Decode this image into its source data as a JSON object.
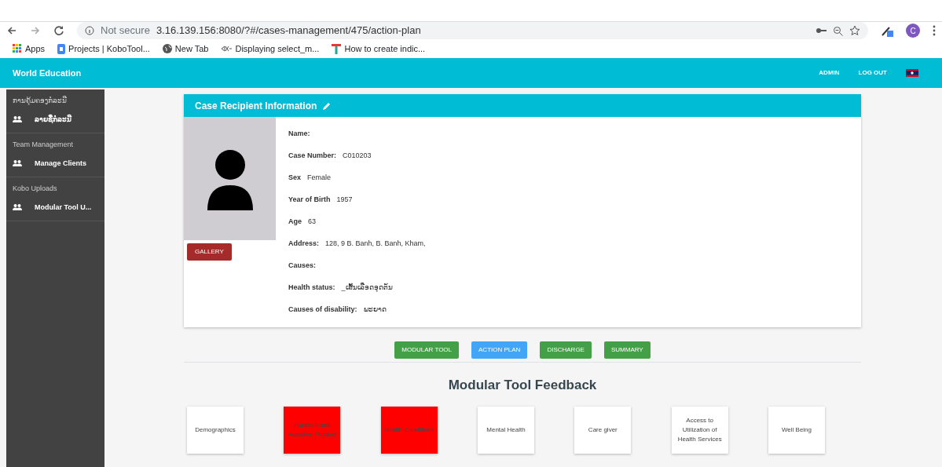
{
  "browser": {
    "security": "Not secure",
    "url": "3.16.139.156:8080/?#/cases-management/475/action-plan",
    "profile": "C",
    "bookmarks": [
      {
        "label": "Apps",
        "kind": "apps"
      },
      {
        "label": "Projects | KoboTool...",
        "kind": "doc"
      },
      {
        "label": "New Tab",
        "kind": "globe"
      },
      {
        "label": "Displaying select_m...",
        "kind": "gk"
      },
      {
        "label": "How to create indic...",
        "kind": "t"
      }
    ]
  },
  "navbar": {
    "brand": "World Education",
    "links": [
      "ADMIN",
      "LOG OUT"
    ]
  },
  "sidebar": {
    "sections": [
      {
        "title": "ການຄຸ້ມຄອງກໍລະນີ",
        "items": [
          "ລາຍຊື່ກໍລະນີ"
        ]
      },
      {
        "title": "Team Management",
        "items": [
          "Manage Clients"
        ]
      },
      {
        "title": "Kobo Uploads",
        "items": [
          "Modular Tool U..."
        ]
      }
    ]
  },
  "case_card": {
    "title": "Case Recipient Information",
    "gallery_button": "GALLERY",
    "fields": [
      {
        "label": "Name:"
      },
      {
        "label": "Case Number:",
        "value": "C010203"
      },
      {
        "label": "Sex",
        "value": "Female"
      },
      {
        "label": "Year of Birth",
        "value": "1957"
      },
      {
        "label": "Age",
        "value": "63"
      },
      {
        "label": "Address:",
        "value": "128, 9 B. Banh, B. Banh, Kham,"
      },
      {
        "label": "Causes:"
      },
      {
        "label": "Health status:",
        "value": "_ເສັ້ນເລືອດອຸດຕັນ"
      },
      {
        "label": "Causes of disability:",
        "value": "ພະຍາດ"
      }
    ]
  },
  "tabs": [
    {
      "label": "MODULAR TOOL",
      "selected": false
    },
    {
      "label": "ACTION PLAN",
      "selected": true
    },
    {
      "label": "DISCHARGE",
      "selected": false
    },
    {
      "label": "SUMMARY",
      "selected": false
    }
  ],
  "feedback": {
    "title": "Modular Tool Feedback",
    "tiles": [
      {
        "label": "Demographics",
        "color": "#ffffff"
      },
      {
        "label": "Function and Assistive Product",
        "color": "#ff0000"
      },
      {
        "label": "Health Conditions",
        "color": "#ff0000"
      },
      {
        "label": "Mental Health",
        "color": "#ffffff"
      },
      {
        "label": "Care giver",
        "color": "#ffffff"
      },
      {
        "label": "Access to Utilization of Health Services",
        "color": "#ffffff"
      },
      {
        "label": "Well Being",
        "color": "#ffffff"
      }
    ]
  }
}
